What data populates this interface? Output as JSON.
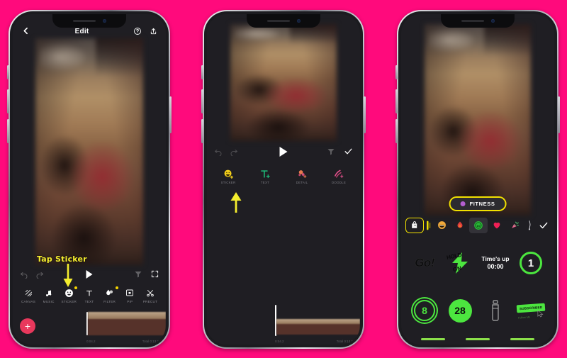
{
  "meta": {
    "background_color": "#FF0A7C",
    "accent_yellow": "#F2E100",
    "neon_green": "#4CE63F",
    "add_button_color": "#E8385C",
    "panels": 3
  },
  "annotations": {
    "tap_sticker_label": "Tap Sticker"
  },
  "phone1": {
    "appbar": {
      "title": "Edit",
      "back_icon": "chevron-left-icon",
      "help_icon": "question-circle-icon",
      "share_icon": "share-up-icon"
    },
    "controls": {
      "undo_icon": "undo-icon",
      "redo_icon": "redo-icon",
      "play_icon": "play-icon",
      "filter_icon": "filter-icon",
      "fullscreen_icon": "expand-icon"
    },
    "toolbar": [
      {
        "label": "CANVAS",
        "icon": "canvas-icon",
        "badge": false
      },
      {
        "label": "MUSIC",
        "icon": "music-note-icon",
        "badge": false
      },
      {
        "label": "STICKER",
        "icon": "smiley-icon",
        "badge": true
      },
      {
        "label": "TEXT",
        "icon": "text-t-icon",
        "badge": false
      },
      {
        "label": "FILTER",
        "icon": "filter-drop-icon",
        "badge": true
      },
      {
        "label": "PIP",
        "icon": "picture-in-picture-icon",
        "badge": false
      },
      {
        "label": "PRECUT",
        "icon": "scissors-icon",
        "badge": false
      }
    ],
    "timeline": {
      "add_label": "+",
      "current_time": "0:04.2",
      "total_time": "Total 0:13.8"
    }
  },
  "phone2": {
    "controls": {
      "undo_icon": "undo-icon",
      "redo_icon": "redo-icon",
      "play_icon": "play-icon",
      "filter_icon": "filter-icon",
      "confirm_icon": "check-icon"
    },
    "toolbar": [
      {
        "label": "STICKER",
        "icon": "smiley-plus-icon"
      },
      {
        "label": "TEXT",
        "icon": "text-t-plus-icon"
      },
      {
        "label": "DETAIL",
        "icon": "detail-plus-icon"
      },
      {
        "label": "DOODLE",
        "icon": "doodle-plus-icon"
      }
    ],
    "timeline": {
      "current_time": "0:04.2",
      "total_time": "Total 0:13.8"
    }
  },
  "phone3": {
    "category_pill": {
      "label": "FITNESS",
      "dot_color": "#B45FD0"
    },
    "categories": [
      {
        "name": "sticker-bag-icon",
        "state": "selected-outline"
      },
      {
        "name": "scroll-handle-icon",
        "state": "normal"
      },
      {
        "name": "grin-emoji-icon",
        "state": "normal"
      },
      {
        "name": "flame-icon",
        "state": "normal"
      },
      {
        "name": "fitness-badge-icon",
        "state": "selected-box"
      },
      {
        "name": "heart-icon",
        "state": "normal"
      },
      {
        "name": "party-icon",
        "state": "normal"
      },
      {
        "name": "brush-icon",
        "state": "normal"
      },
      {
        "name": "check-icon",
        "state": "normal"
      }
    ],
    "stickers": [
      {
        "id": "go",
        "label": "Go!"
      },
      {
        "id": "hold-on",
        "label_top": "HOLD",
        "label_bottom": "ON"
      },
      {
        "id": "times-up",
        "label": "Time's up",
        "timer": "00:00"
      },
      {
        "id": "counter-1",
        "label": "1"
      },
      {
        "id": "counter-8",
        "label": "8"
      },
      {
        "id": "counter-28",
        "label": "28"
      },
      {
        "id": "bottle",
        "label": ""
      },
      {
        "id": "subscribed",
        "label": "SUBSCRIBED",
        "sublabel": "Follow Me"
      }
    ]
  }
}
